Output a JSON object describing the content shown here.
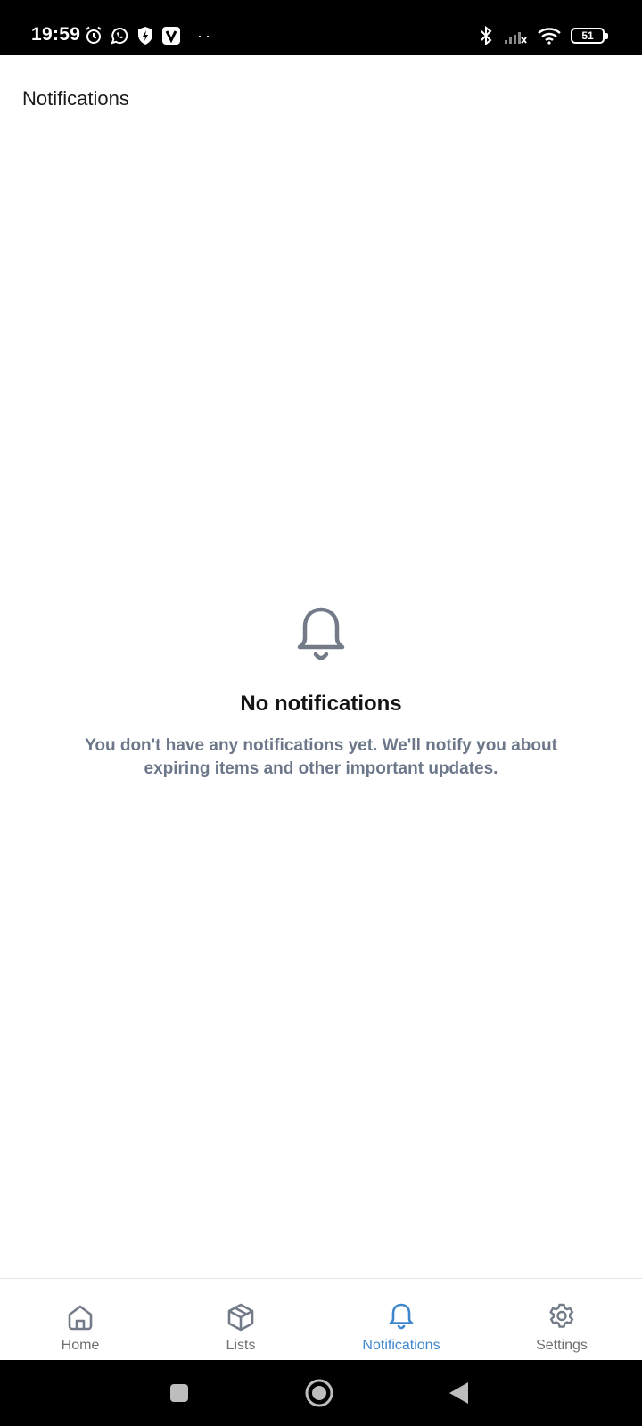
{
  "status_bar": {
    "time": "19:59",
    "left_icons": [
      "alarm-icon",
      "whatsapp-icon",
      "shield-icon",
      "v-app-icon"
    ],
    "dots": "··",
    "right_icons": [
      "bluetooth-icon",
      "signal-icon",
      "wifi-icon"
    ],
    "battery": "51"
  },
  "header": {
    "title": "Notifications"
  },
  "empty_state": {
    "icon": "bell-icon",
    "title": "No notifications",
    "message": "You don't have any notifications yet. We'll notify you about expiring items and other important updates."
  },
  "bottom_nav": {
    "items": [
      {
        "label": "Home",
        "icon": "home-icon",
        "active": false
      },
      {
        "label": "Lists",
        "icon": "box-icon",
        "active": false
      },
      {
        "label": "Notifications",
        "icon": "bell-icon",
        "active": true
      },
      {
        "label": "Settings",
        "icon": "gear-icon",
        "active": false
      }
    ]
  },
  "colors": {
    "accent": "#3f87cc",
    "inactive": "#6f6f6f",
    "muted_text": "#6c7789",
    "icon_gray": "#737b88"
  },
  "system_nav": [
    "recents-button",
    "home-button",
    "back-button"
  ]
}
